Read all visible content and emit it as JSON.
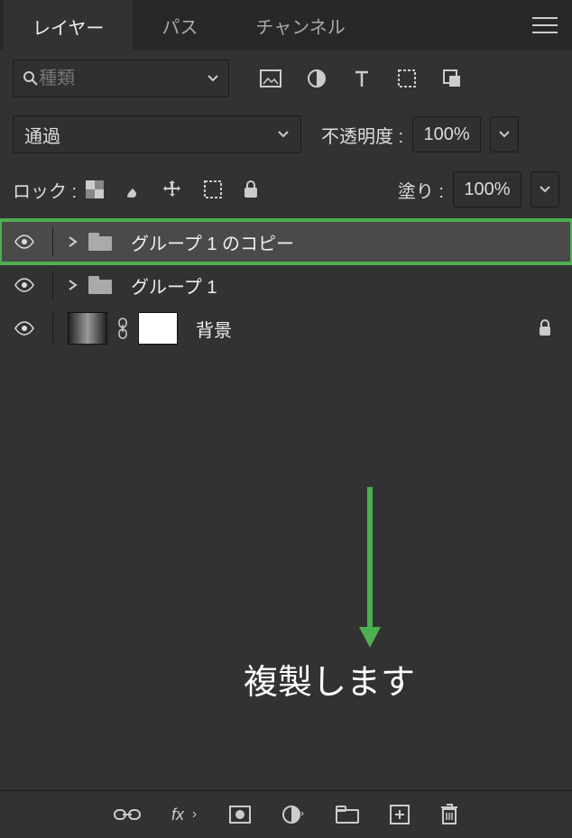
{
  "tabs": {
    "layers": "レイヤー",
    "paths": "パス",
    "channels": "チャンネル"
  },
  "filter": {
    "placeholder": "種類"
  },
  "blend": {
    "mode": "通過",
    "opacity_label": "不透明度 :",
    "opacity_value": "100%"
  },
  "lock": {
    "label": "ロック :",
    "fill_label": "塗り :",
    "fill_value": "100%"
  },
  "layers": {
    "items": [
      {
        "name": "グループ 1 のコピー"
      },
      {
        "name": "グループ 1"
      },
      {
        "name": "背景"
      }
    ]
  },
  "annotation": {
    "text": "複製します"
  }
}
